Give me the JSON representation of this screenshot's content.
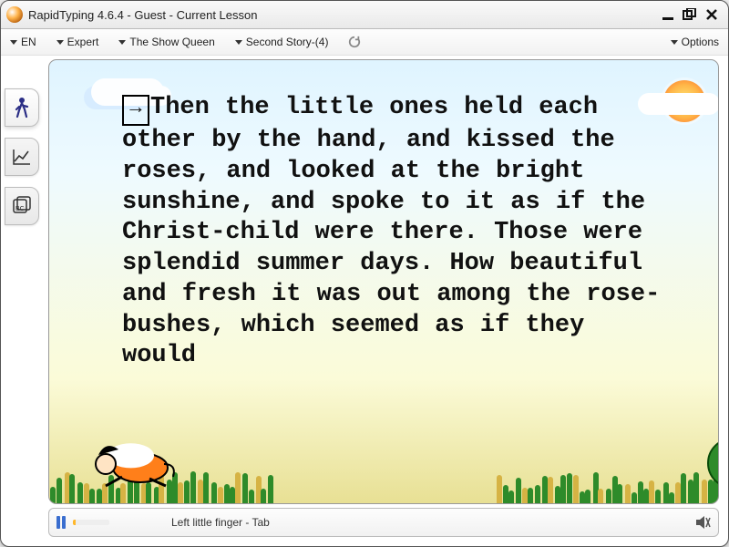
{
  "window": {
    "title": "RapidTyping 4.6.4 - Guest - Current Lesson"
  },
  "toolbar": {
    "language": "EN",
    "level": "Expert",
    "course": "The Show Queen",
    "lesson": "Second Story-(4)",
    "options": "Options"
  },
  "lesson_text": "Then the little ones held each other by the hand, and kissed the roses, and looked at the bright sunshine, and spoke to it as if the Christ-child were there. Those were splendid summer days. How beautiful and fresh it was out among the rose-bushes, which seemed as if they would",
  "cursor_symbol": "→",
  "status": {
    "hint": "Left little finger - Tab"
  },
  "icons": {
    "person": "person-walking-icon",
    "chart": "chart-line-icon",
    "cards": "lesson-cards-icon"
  }
}
